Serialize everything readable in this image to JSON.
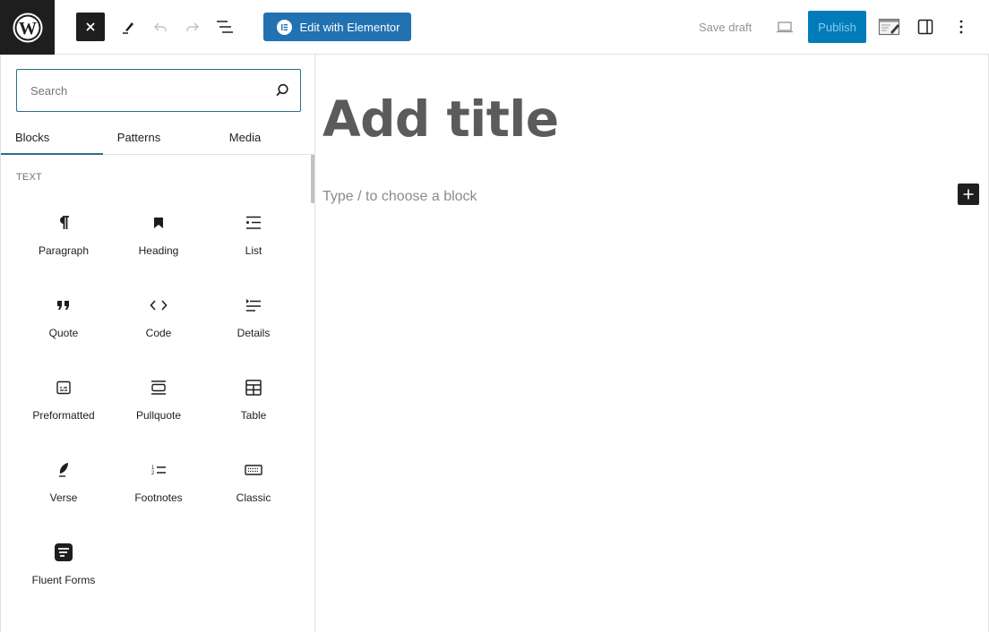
{
  "header": {
    "logo_icon": "wordpress-logo-icon",
    "close_icon": "close-icon",
    "tools_icon": "pencil-icon",
    "undo_icon": "undo-icon",
    "redo_icon": "redo-icon",
    "outline_icon": "document-overview-icon",
    "elementor_label": "Edit with Elementor",
    "save_draft_label": "Save draft",
    "preview_icon": "laptop-preview-icon",
    "publish_label": "Publish",
    "notes_icon": "notes-edit-icon",
    "settings_icon": "sidebar-toggle-icon",
    "options_icon": "more-vertical-icon",
    "colors": {
      "elementor": "#2271b1",
      "publish": "#007cba",
      "dark": "#1e1e1e"
    }
  },
  "inserter": {
    "search": {
      "placeholder": "Search",
      "value": ""
    },
    "tabs": [
      {
        "label": "Blocks",
        "active": true
      },
      {
        "label": "Patterns",
        "active": false
      },
      {
        "label": "Media",
        "active": false
      }
    ],
    "category": "Text",
    "blocks": [
      {
        "label": "Paragraph",
        "icon": "paragraph-icon"
      },
      {
        "label": "Heading",
        "icon": "heading-bookmark-icon"
      },
      {
        "label": "List",
        "icon": "list-icon"
      },
      {
        "label": "Quote",
        "icon": "quote-icon"
      },
      {
        "label": "Code",
        "icon": "code-icon"
      },
      {
        "label": "Details",
        "icon": "details-icon"
      },
      {
        "label": "Preformatted",
        "icon": "preformatted-icon"
      },
      {
        "label": "Pullquote",
        "icon": "pullquote-icon"
      },
      {
        "label": "Table",
        "icon": "table-icon"
      },
      {
        "label": "Verse",
        "icon": "verse-feather-icon"
      },
      {
        "label": "Footnotes",
        "icon": "footnotes-icon"
      },
      {
        "label": "Classic",
        "icon": "keyboard-icon"
      },
      {
        "label": "Fluent Forms",
        "icon": "fluent-forms-icon"
      }
    ]
  },
  "editor": {
    "title_placeholder": "Add title",
    "block_placeholder": "Type / to choose a block",
    "add_block_icon": "plus-icon"
  }
}
